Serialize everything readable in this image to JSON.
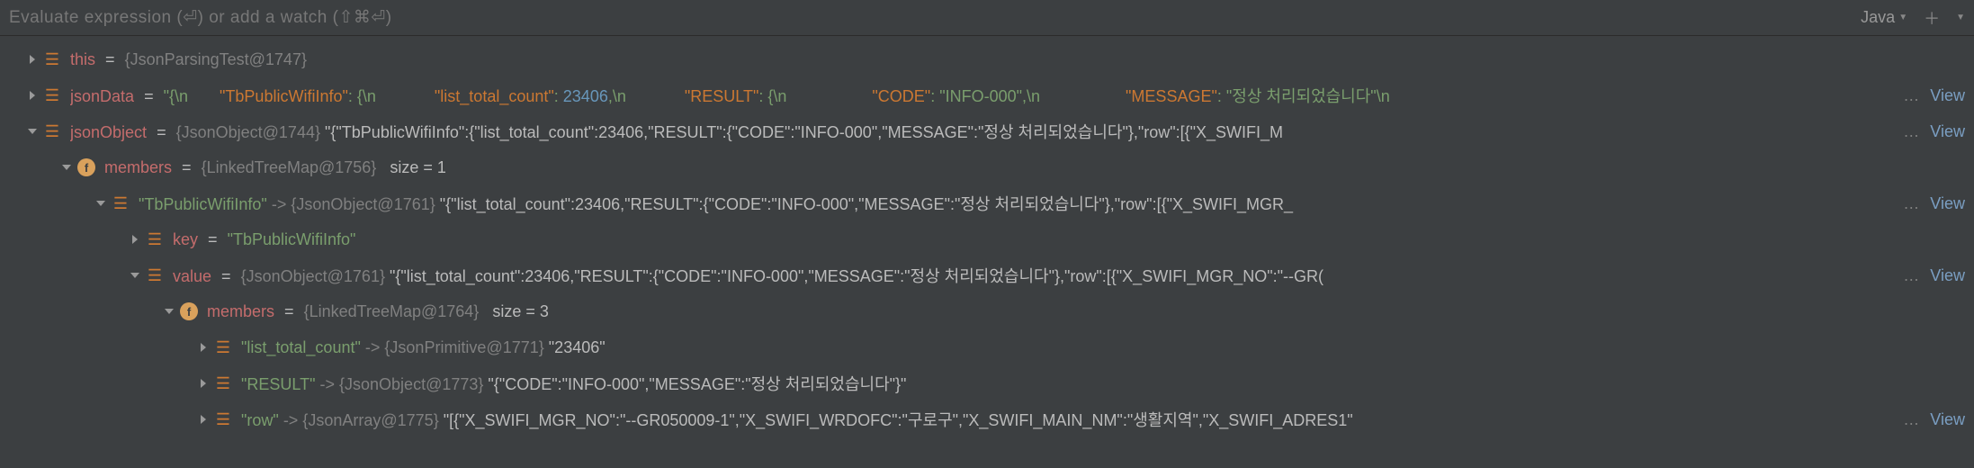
{
  "header": {
    "placeholder": "Evaluate expression (⏎) or add a watch (⇧⌘⏎)",
    "language": "Java"
  },
  "view_link": "View",
  "ellipsis": "…",
  "rows": {
    "r0": {
      "name": "this",
      "type": "{JsonParsingTest@1747}"
    },
    "r1": {
      "name": "jsonData",
      "prefix": "\"{\\n",
      "k1": "\"TbPublicWifiInfo\"",
      "p1": ": {\\n",
      "k2": "\"list_total_count\"",
      "p2": ": ",
      "n2": "23406",
      "p2b": ",\\n",
      "k3": "\"RESULT\"",
      "p3": ": {\\n",
      "k4": "\"CODE\"",
      "p4": ": ",
      "v4": "\"INFO-000\"",
      "p4b": ",\\n",
      "k5": "\"MESSAGE\"",
      "p5": ": ",
      "v5": "\"정상 처리되었습니다\"",
      "suffix": "\\n"
    },
    "r2": {
      "name": "jsonObject",
      "type": "{JsonObject@1744}",
      "val": "\"{\"TbPublicWifiInfo\":{\"list_total_count\":23406,\"RESULT\":{\"CODE\":\"INFO-000\",\"MESSAGE\":\"정상 처리되었습니다\"},\"row\":[{\"X_SWIFI_M"
    },
    "r3": {
      "name": "members",
      "type": "{LinkedTreeMap@1756}",
      "size": "size = 1"
    },
    "r4": {
      "key": "\"TbPublicWifiInfo\"",
      "arrow": "->",
      "type": "{JsonObject@1761}",
      "val": "\"{\"list_total_count\":23406,\"RESULT\":{\"CODE\":\"INFO-000\",\"MESSAGE\":\"정상 처리되었습니다\"},\"row\":[{\"X_SWIFI_MGR_"
    },
    "r5": {
      "name": "key",
      "val": "\"TbPublicWifiInfo\""
    },
    "r6": {
      "name": "value",
      "type": "{JsonObject@1761}",
      "val": "\"{\"list_total_count\":23406,\"RESULT\":{\"CODE\":\"INFO-000\",\"MESSAGE\":\"정상 처리되었습니다\"},\"row\":[{\"X_SWIFI_MGR_NO\":\"--GR("
    },
    "r7": {
      "name": "members",
      "type": "{LinkedTreeMap@1764}",
      "size": "size = 3"
    },
    "r8": {
      "key": "\"list_total_count\"",
      "arrow": "->",
      "type": "{JsonPrimitive@1771}",
      "val": "\"23406\""
    },
    "r9": {
      "key": "\"RESULT\"",
      "arrow": "->",
      "type": "{JsonObject@1773}",
      "val": "\"{\"CODE\":\"INFO-000\",\"MESSAGE\":\"정상 처리되었습니다\"}\""
    },
    "r10": {
      "key": "\"row\"",
      "arrow": "->",
      "type": "{JsonArray@1775}",
      "val": "\"[{\"X_SWIFI_MGR_NO\":\"--GR050009-1\",\"X_SWIFI_WRDOFC\":\"구로구\",\"X_SWIFI_MAIN_NM\":\"생활지역\",\"X_SWIFI_ADRES1\""
    }
  }
}
